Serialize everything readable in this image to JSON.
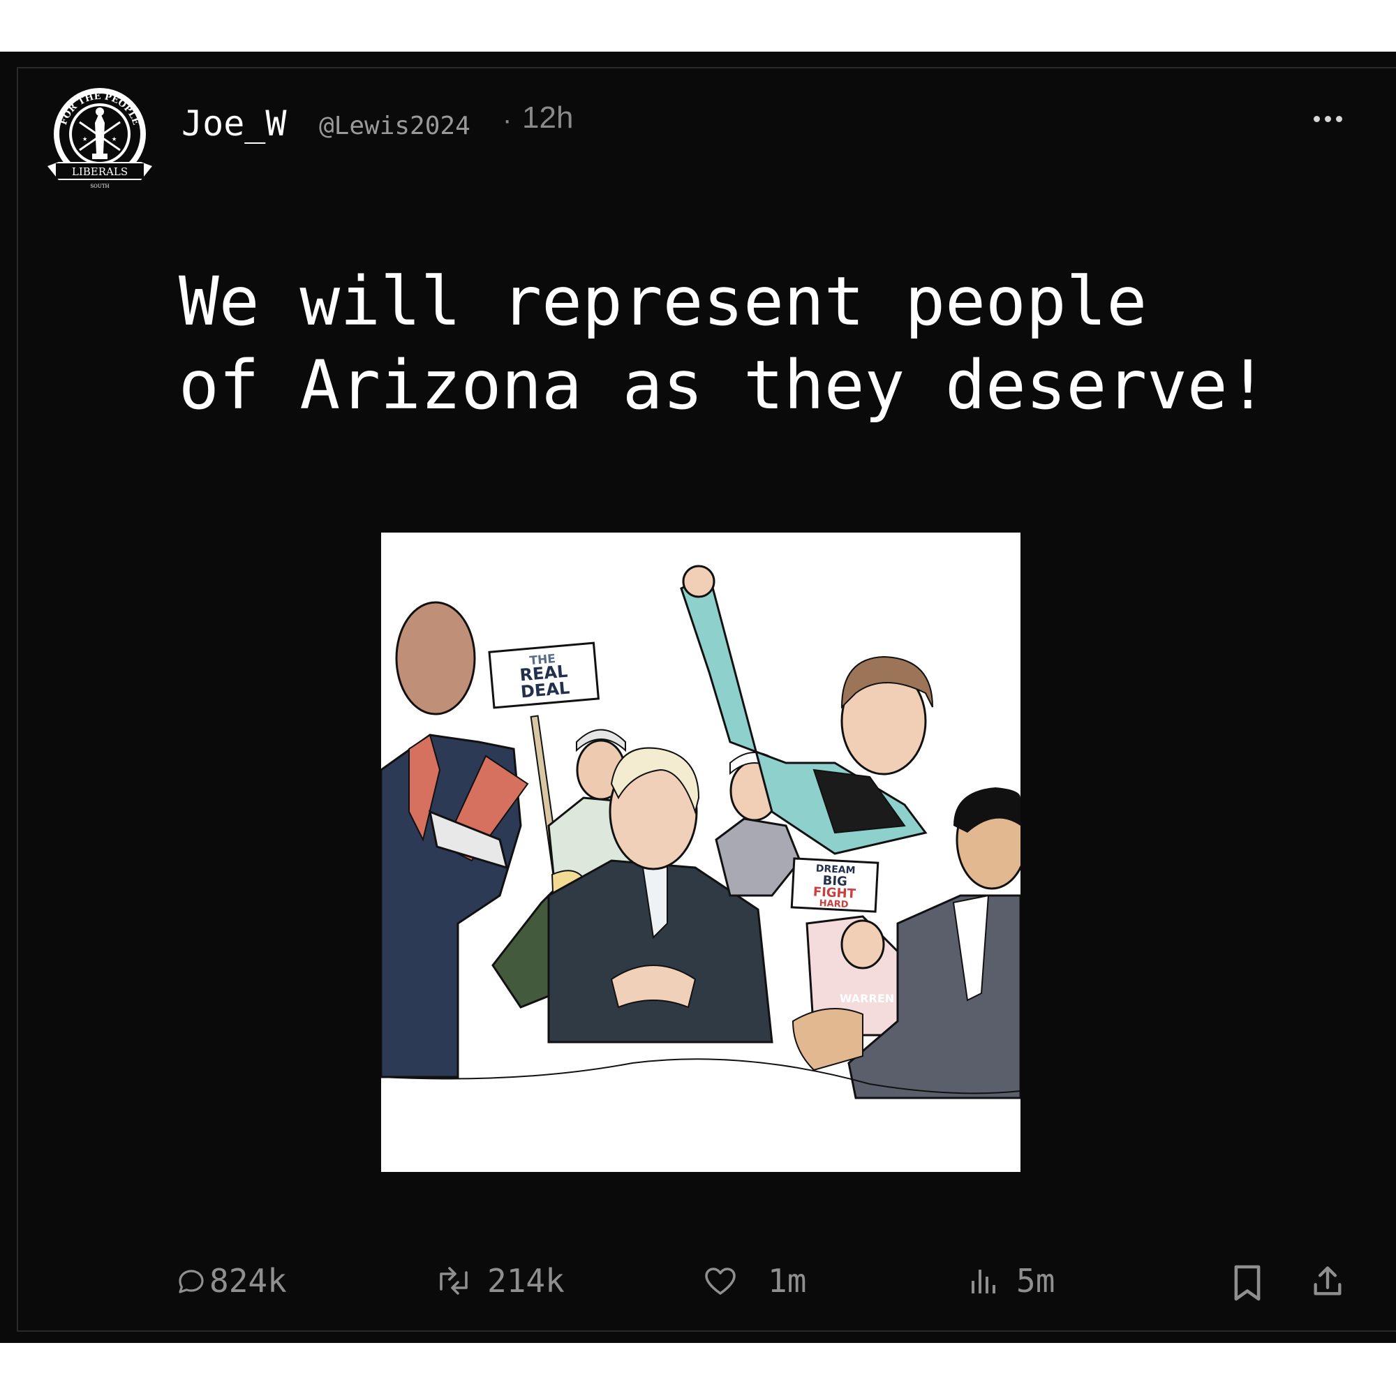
{
  "tweet": {
    "display_name": "Joe_W",
    "handle": "@Lewis2024",
    "separator": "·",
    "time": "12h",
    "text": "We will represent people\nof Arizona as they deserve!",
    "avatar": {
      "icon": "liberals-emblem-icon",
      "ring_text": "FOR THE PEOPLE",
      "banner_text": "LIBERALS",
      "sub_text": "SOUTH"
    },
    "media": {
      "signs": [
        "THE",
        "REAL",
        "DEAL",
        "DREAM",
        "BIG",
        "FIGHT",
        "HARD",
        "WARREN"
      ]
    }
  },
  "actions": {
    "replies": "824k",
    "retweets": "214k",
    "likes": "1m",
    "views": "5m"
  },
  "icons": [
    "reply-icon",
    "retweet-icon",
    "heart-icon",
    "views-icon",
    "bookmark-icon",
    "share-icon",
    "more-icon"
  ],
  "colors": {
    "background": "#0a0a0a",
    "text": "#ffffff",
    "muted": "#8f8f8f"
  }
}
